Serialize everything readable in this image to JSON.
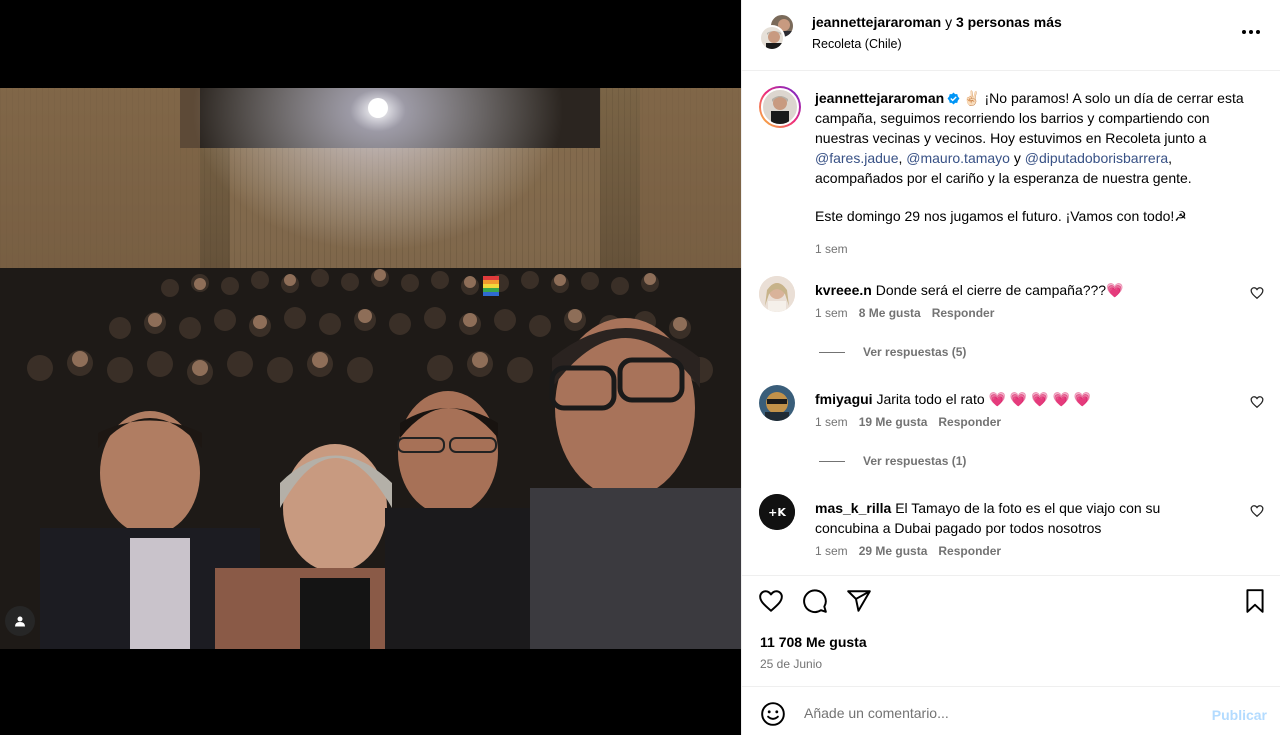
{
  "header": {
    "username": "jeannettejararoman",
    "and_text": "y",
    "others_text": "3 personas más",
    "location": "Recoleta (Chile)",
    "more_icon": "more-horizontal-icon"
  },
  "caption": {
    "username": "jeannettejararoman",
    "text_before": "✌🏻 ¡No paramos! A solo un día de cerrar esta campaña, seguimos recorriendo los barrios y compartiendo con nuestras vecinas y vecinos. Hoy estuvimos en Recoleta junto a ",
    "mention1": "@fares.jadue",
    "sep1": ", ",
    "mention2": "@mauro.tamayo",
    "sep2": " y ",
    "mention3": "@diputadoborisbarrera",
    "text_after": ", acompañados por el cariño y la esperanza de nuestra gente.",
    "text2": "Este domingo 29 nos jugamos el futuro. ¡Vamos con todo!☭",
    "time": "1 sem"
  },
  "comments": [
    {
      "username": "kvreee.n",
      "text": "Donde será el cierre de campaña???💗",
      "time": "1 sem",
      "likes": "8 Me gusta",
      "reply": "Responder",
      "replies": "Ver respuestas (5)"
    },
    {
      "username": "fmiyagui",
      "text": "Jarita todo el rato 💗 💗 💗 💗 💗",
      "time": "1 sem",
      "likes": "19 Me gusta",
      "reply": "Responder",
      "replies": "Ver respuestas (1)"
    },
    {
      "username": "mas_k_rilla",
      "text": "El Tamayo de la foto es el que viajo con su concubina a Dubai pagado por todos nosotros",
      "time": "1 sem",
      "likes": "29 Me gusta",
      "reply": "Responder"
    }
  ],
  "actions": {
    "likes": "11 708 Me gusta",
    "date": "25 de Junio"
  },
  "add_comment": {
    "placeholder": "Añade un comentario...",
    "publish": "Publicar"
  },
  "colors": {
    "link": "#385185",
    "secondary": "#737373",
    "publish_disabled": "#b3dbff",
    "verified": "#0095f6"
  }
}
